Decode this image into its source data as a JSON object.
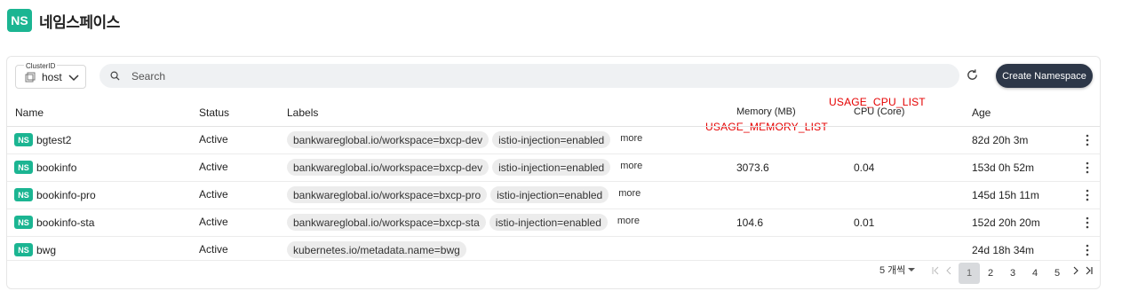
{
  "header": {
    "logo_text": "NS",
    "title": "네임스페이스"
  },
  "toolbar": {
    "cluster_label": "ClusterID",
    "cluster_value": "host",
    "search_placeholder": "Search",
    "create_label": "Create Namespace"
  },
  "columns": {
    "name": "Name",
    "status": "Status",
    "labels": "Labels",
    "memory": "Memory (MB)",
    "cpu": "CPU (Core)",
    "age": "Age"
  },
  "overlays": {
    "cpu": "USAGE_CPU_LIST",
    "memory": "USAGE_MEMORY_LIST"
  },
  "rows": [
    {
      "badge": "NS",
      "name": "bgtest2",
      "status": "Active",
      "labels": [
        "bankwareglobal.io/workspace=bxcp-dev",
        "istio-injection=enabled"
      ],
      "more": "more",
      "memory": "",
      "cpu": "",
      "age": "82d 20h 3m"
    },
    {
      "badge": "NS",
      "name": "bookinfo",
      "status": "Active",
      "labels": [
        "bankwareglobal.io/workspace=bxcp-dev",
        "istio-injection=enabled"
      ],
      "more": "more",
      "memory": "3073.6",
      "cpu": "0.04",
      "age": "153d 0h 52m"
    },
    {
      "badge": "NS",
      "name": "bookinfo-pro",
      "status": "Active",
      "labels": [
        "bankwareglobal.io/workspace=bxcp-pro",
        "istio-injection=enabled"
      ],
      "more": "more",
      "memory": "",
      "cpu": "",
      "age": "145d 15h 11m"
    },
    {
      "badge": "NS",
      "name": "bookinfo-sta",
      "status": "Active",
      "labels": [
        "bankwareglobal.io/workspace=bxcp-sta",
        "istio-injection=enabled"
      ],
      "more": "more",
      "memory": "104.6",
      "cpu": "0.01",
      "age": "152d 20h 20m"
    },
    {
      "badge": "NS",
      "name": "bwg",
      "status": "Active",
      "labels": [
        "kubernetes.io/metadata.name=bwg"
      ],
      "more": "",
      "memory": "",
      "cpu": "",
      "age": "24d 18h 34m"
    }
  ],
  "pagination": {
    "per_page": "5 개씩",
    "pages": [
      "1",
      "2",
      "3",
      "4",
      "5"
    ],
    "current": "1"
  },
  "colors": {
    "accent": "#1bb592",
    "primary_button": "#2d3748",
    "overlay_text": "#e50000"
  }
}
